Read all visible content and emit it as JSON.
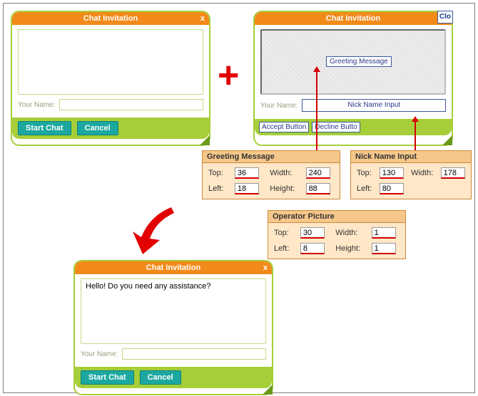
{
  "chat_template": {
    "title": "Chat Invitation",
    "close_x": "x",
    "name_label": "Your Name:",
    "start_label": "Start Chat",
    "cancel_label": "Cancel"
  },
  "chat_design": {
    "title": "Chat Invitation",
    "close_label": "Clo",
    "name_label": "Your Name:",
    "greeting_placeholder": "Greeting Message",
    "nick_placeholder": "Nick Name Input",
    "accept_label": "Accept Button",
    "decline_label": "Decline Butto"
  },
  "chat_result": {
    "title": "Chat Invitation",
    "close_x": "x",
    "name_label": "Your Name:",
    "greeting_text": "Hello! Do you need any assistance?",
    "start_label": "Start Chat",
    "cancel_label": "Cancel"
  },
  "panels": {
    "greeting": {
      "title": "Greeting Message",
      "top_label": "Top:",
      "top": "36",
      "left_label": "Left:",
      "left": "18",
      "width_label": "Width:",
      "width": "240",
      "height_label": "Height:",
      "height": "88"
    },
    "nick": {
      "title": "Nick Name Input",
      "top_label": "Top:",
      "top": "130",
      "left_label": "Left:",
      "left": "80",
      "width_label": "Width:",
      "width": "178"
    },
    "operator": {
      "title": "Operator Picture",
      "top_label": "Top:",
      "top": "30",
      "left_label": "Left:",
      "left": "8",
      "width_label": "Width:",
      "width": "1",
      "height_label": "Height:",
      "height": "1"
    }
  },
  "plus_sign": "+"
}
